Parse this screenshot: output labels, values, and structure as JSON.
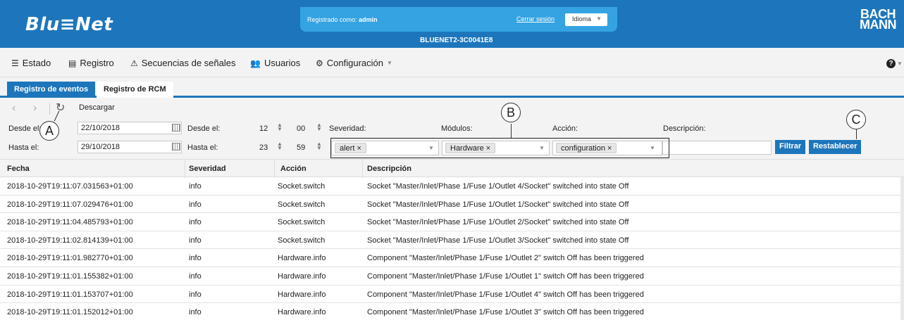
{
  "header": {
    "logo": "Blu≡Net",
    "logged_in_label": "Registrado como:",
    "user": "admin",
    "logout": "Cerrar sesión",
    "language": "Idioma",
    "device_name": "BLUENET2-3C0041E8",
    "brand": "BACH MANN",
    "brand_line1": "BACH",
    "brand_line2": "MANN",
    "colors": {
      "primary": "#1d76bb",
      "userbox": "#35a3e2"
    }
  },
  "mainnav": {
    "items": [
      {
        "label": "Estado",
        "icon": "menu-icon"
      },
      {
        "label": "Registro",
        "icon": "document-icon"
      },
      {
        "label": "Secuencias de señales",
        "icon": "warning-icon"
      },
      {
        "label": "Usuarios",
        "icon": "users-icon"
      },
      {
        "label": "Configuración",
        "icon": "gear-icon"
      }
    ],
    "help_icon": "help-icon"
  },
  "tabs": [
    {
      "label": "Registro de eventos",
      "active": true
    },
    {
      "label": "Registro de RCM",
      "active": false
    }
  ],
  "toolbar": {
    "download": "Descargar"
  },
  "filters": {
    "from_label": "Desde el:",
    "to_label": "Hasta el:",
    "from_date": "22/10/2018",
    "to_date": "29/10/2018",
    "from_time_label": "Desde el:",
    "to_time_label": "Hasta el:",
    "from_hour": "12",
    "from_minute": "00",
    "to_hour": "23",
    "to_minute": "59",
    "severity_label": "Severidad:",
    "modules_label": "Módulos:",
    "action_label": "Acción:",
    "description_label": "Descripción:",
    "severity_tag": "alert ×",
    "modules_tag": "Hardware ×",
    "action_tag": "configuration ×",
    "description_value": "",
    "filter_button": "Filtrar",
    "reset_button": "Restablecer"
  },
  "callouts": {
    "a": "A",
    "b": "B",
    "c": "C"
  },
  "table": {
    "columns": [
      "Fecha",
      "Severidad",
      "Acción",
      "Descripción"
    ],
    "rows": [
      [
        "2018-10-29T19:11:07.031563+01:00",
        "info",
        "Socket.switch",
        "Socket \"Master/Inlet/Phase 1/Fuse 1/Outlet 4/Socket\" switched into state Off"
      ],
      [
        "2018-10-29T19:11:07.029476+01:00",
        "info",
        "Socket.switch",
        "Socket \"Master/Inlet/Phase 1/Fuse 1/Outlet 1/Socket\" switched into state Off"
      ],
      [
        "2018-10-29T19:11:04.485793+01:00",
        "info",
        "Socket.switch",
        "Socket \"Master/Inlet/Phase 1/Fuse 1/Outlet 2/Socket\" switched into state Off"
      ],
      [
        "2018-10-29T19:11:02.814139+01:00",
        "info",
        "Socket.switch",
        "Socket \"Master/Inlet/Phase 1/Fuse 1/Outlet 3/Socket\" switched into state Off"
      ],
      [
        "2018-10-29T19:11:01.982770+01:00",
        "info",
        "Hardware.info",
        "Component \"Master/Inlet/Phase 1/Fuse 1/Outlet 2\" switch Off has been triggered"
      ],
      [
        "2018-10-29T19:11:01.155382+01:00",
        "info",
        "Hardware.info",
        "Component \"Master/Inlet/Phase 1/Fuse 1/Outlet 1\" switch Off has been triggered"
      ],
      [
        "2018-10-29T19:11:01.153707+01:00",
        "info",
        "Hardware.info",
        "Component \"Master/Inlet/Phase 1/Fuse 1/Outlet 4\" switch Off has been triggered"
      ],
      [
        "2018-10-29T19:11:01.152012+01:00",
        "info",
        "Hardware.info",
        "Component \"Master/Inlet/Phase 1/Fuse 1/Outlet 3\" switch Off has been triggered"
      ]
    ]
  }
}
